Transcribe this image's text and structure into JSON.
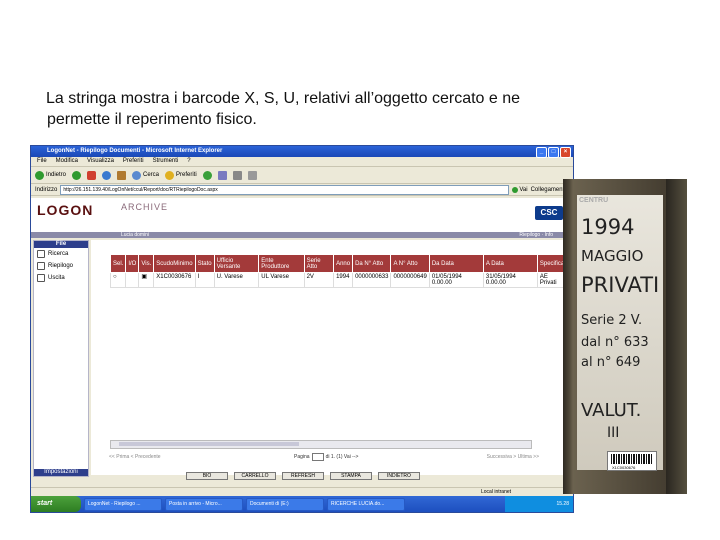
{
  "caption": {
    "line1": "La stringa mostra i barcode X, S, U, relativi all’oggetto cercato e ne",
    "line2": "permette il reperimento fisico."
  },
  "window": {
    "title": "LogonNet - Riepilogo Documenti - Microsoft Internet Explorer",
    "menu": [
      "File",
      "Modifica",
      "Visualizza",
      "Preferiti",
      "Strumenti",
      "?"
    ],
    "toolbar": {
      "back": "Indietro",
      "search": "Cerca",
      "favorites": "Preferiti"
    },
    "address": {
      "label": "Indirizzo",
      "url": "http://26.151.139.40/LogOnNet/ccul/Report/doc/RTRiepilogoDoc.aspx",
      "go": "Vai",
      "links": "Collegamenti"
    }
  },
  "app": {
    "logo": "LOGON",
    "logo_sub": "ARCHIVE",
    "brand": "CSC",
    "subbar_left": "Lucia domini",
    "subbar_right": "Riepilogo · Info",
    "nav": {
      "header": "File",
      "items": [
        "Ricerca",
        "Riepilogo",
        "Uscita"
      ],
      "footer": "Impostazioni"
    },
    "table": {
      "headers": [
        "Sel.",
        "I/O",
        "Vis.",
        "ScudoMinimo",
        "Stato",
        "Ufficio Versante",
        "Ente Produttore",
        "Serie Atto",
        "Anno",
        "Da N° Atto",
        "A N° Atto",
        "Da Data",
        "A Data",
        "Specifica"
      ],
      "rows": [
        [
          "○",
          "",
          "▣",
          "X1C0030676",
          "I",
          "U. Varese",
          "UL Varese",
          "2V",
          "1994",
          "0000000633",
          "0000000649",
          "01/05/1994 0.00.00",
          "31/05/1994 0.00.00",
          "AE Privati"
        ]
      ]
    },
    "pager": {
      "prev": "<< Prima < Precedente",
      "page_label": "Pagina",
      "page_of": "di 1. (1) Vai -->",
      "next": "Successiva > Ultima >>"
    },
    "buttons": [
      "BIO",
      "CARRELLO",
      "REFRESH",
      "STAMPA",
      "INDIETRO"
    ]
  },
  "status": {
    "zone": "Local intranet"
  },
  "taskbar": {
    "start": "start",
    "tasks": [
      "LogonNet - Riepilogo ...",
      "Posta in arrivo - Micro...",
      "Documenti di (E:)",
      "RICERCHE LUCIA.do..."
    ],
    "clock": "15.28"
  },
  "photo": {
    "stamp": "CENTRU",
    "year": "1994",
    "month": "MAGGIO",
    "word": "PRIVATI",
    "serie": "Serie 2 V.",
    "dal": "dal n° 633",
    "al": "al n° 649",
    "valut": "VALUT.",
    "roman": "III",
    "barcode_num": "X1C0030676"
  }
}
